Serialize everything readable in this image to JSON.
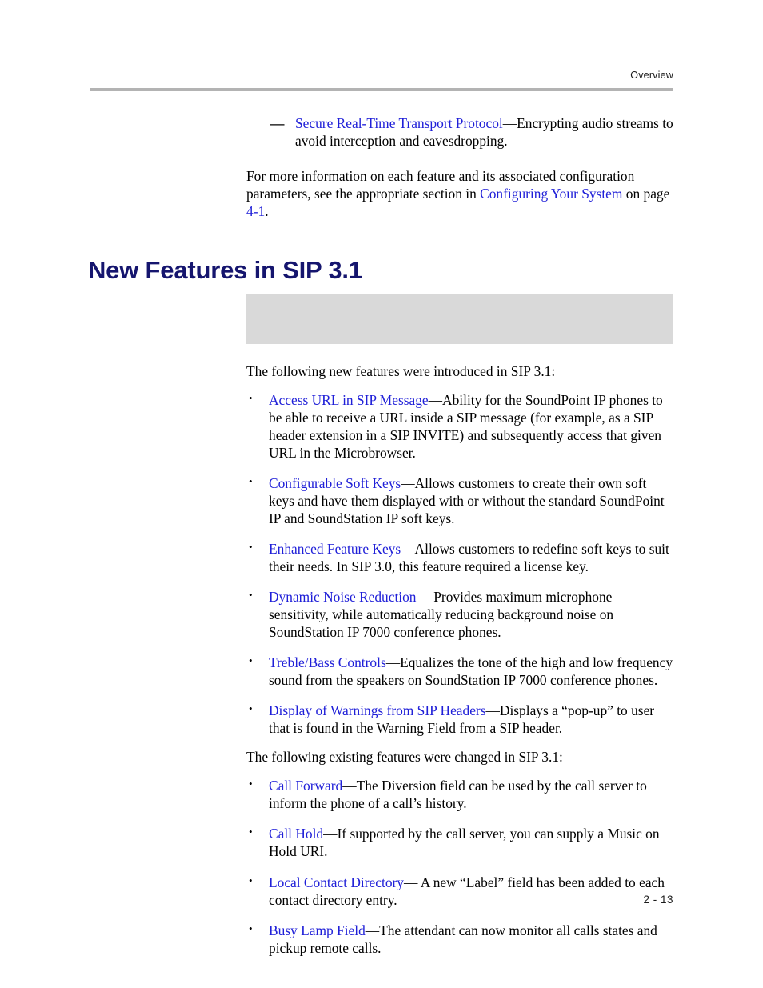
{
  "header": {
    "running_head": "Overview"
  },
  "footer": {
    "page_number": "2 - 13"
  },
  "colors": {
    "link": "#2020d8",
    "heading": "#15156e",
    "rule": "#b3b3b3",
    "note_box": "#d9d9d9"
  },
  "top_section": {
    "dash_item": {
      "marker": "—",
      "link": "Secure Real-Time Transport Protocol",
      "separator": "—",
      "text": "Encrypting audio streams to avoid interception and eavesdropping."
    },
    "paragraph": {
      "part1": "For more information on each feature and its associated configuration parameters, see the appropriate section in ",
      "link1": "Configuring Your System",
      "part2": " on page ",
      "link2": "4-1",
      "part3": "."
    }
  },
  "section": {
    "heading": "New Features in SIP 3.1",
    "note_box_caption": ""
  },
  "intro_new": "The following new features were introduced in SIP 3.1:",
  "new_features": [
    {
      "bullet": "•",
      "link": "Access URL in SIP Message",
      "separator": "—",
      "text": "Ability for the SoundPoint IP phones to be able to receive a URL inside a SIP message (for example, as a SIP header extension in a SIP INVITE) and subsequently access that given URL in the Microbrowser."
    },
    {
      "bullet": "•",
      "link": "Configurable Soft Keys",
      "separator": "—",
      "text": "Allows customers to create their own soft keys and have them displayed with or without the standard SoundPoint IP and SoundStation IP soft keys."
    },
    {
      "bullet": "•",
      "link": "Enhanced Feature Keys",
      "separator": "—",
      "text": "Allows customers to redefine soft keys to suit their needs. In SIP 3.0, this feature required a license key."
    },
    {
      "bullet": "•",
      "link": "Dynamic Noise Reduction",
      "separator": "—",
      "text": " Provides maximum microphone sensitivity, while automatically reducing background noise on SoundStation IP 7000 conference phones."
    },
    {
      "bullet": "•",
      "link": "Treble/Bass Controls",
      "separator": "—",
      "text": "Equalizes the tone of the high and low frequency sound from the speakers on SoundStation IP 7000 conference phones."
    },
    {
      "bullet": "•",
      "link": "Display of Warnings from SIP Headers",
      "separator": "—",
      "text": "Displays a “pop-up” to user that is found in the Warning Field from a SIP header."
    }
  ],
  "intro_changed": "The following existing features were changed in SIP 3.1:",
  "changed_features": [
    {
      "bullet": "•",
      "link": "Call Forward",
      "separator": "—",
      "text": "The Diversion field can be used by the call server to inform the phone of a call’s history."
    },
    {
      "bullet": "•",
      "link": "Call Hold",
      "separator": "—",
      "text": "If supported by the call server, you can supply a Music on Hold URI."
    },
    {
      "bullet": "•",
      "link": "Local Contact Directory",
      "separator": "—",
      "text": " A new “Label” field has been added to each contact directory entry."
    },
    {
      "bullet": "•",
      "link": "Busy Lamp Field",
      "separator": "—",
      "text": "The attendant can now monitor all calls states and pickup remote calls."
    }
  ]
}
